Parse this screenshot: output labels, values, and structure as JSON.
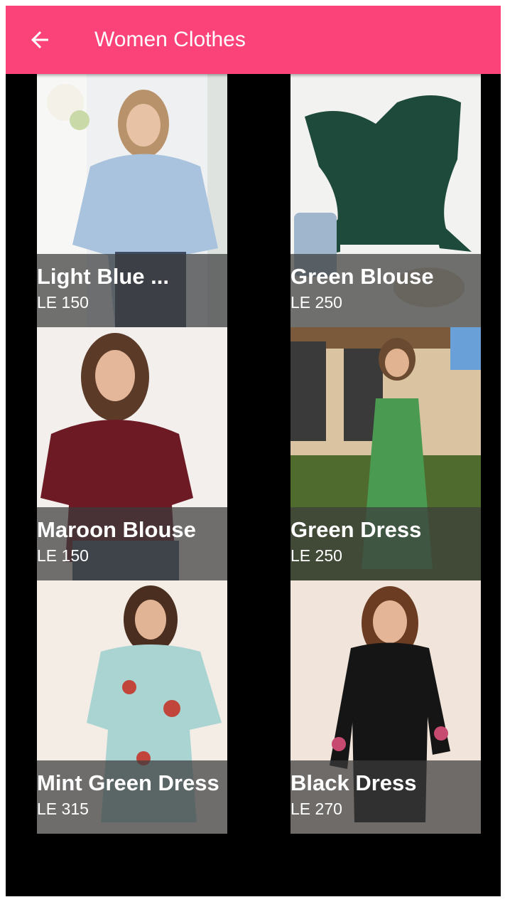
{
  "appbar": {
    "title": "Women Clothes",
    "back_icon": "arrow-left-icon",
    "color": "#fb4279"
  },
  "products": [
    {
      "name": "Light Blue ...",
      "price": "LE 150"
    },
    {
      "name": "Green Blouse",
      "price": "LE 250"
    },
    {
      "name": "Maroon Blouse",
      "price": "LE 150"
    },
    {
      "name": "Green Dress",
      "price": "LE 250"
    },
    {
      "name": "Mint Green Dress",
      "price": "LE 315"
    },
    {
      "name": "Black Dress",
      "price": "LE 270"
    }
  ]
}
